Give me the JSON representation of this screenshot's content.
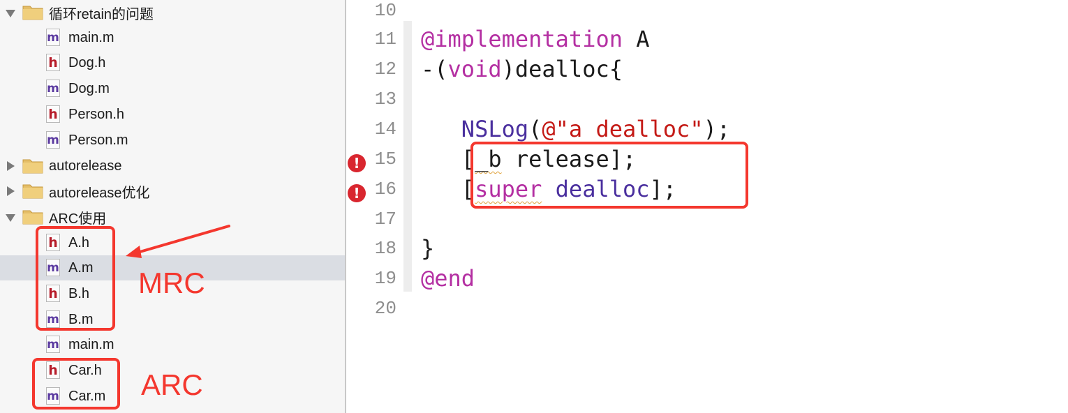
{
  "sidebar": {
    "groups": [
      {
        "name": "循环retain的问题",
        "expanded": true
      },
      {
        "name": "autorelease",
        "expanded": false
      },
      {
        "name": "autorelease优化",
        "expanded": false
      },
      {
        "name": "ARC使用",
        "expanded": true
      }
    ],
    "files_group1": [
      {
        "name": "main.m",
        "type": "m"
      },
      {
        "name": "Dog.h",
        "type": "h"
      },
      {
        "name": "Dog.m",
        "type": "m"
      },
      {
        "name": "Person.h",
        "type": "h"
      },
      {
        "name": "Person.m",
        "type": "m"
      }
    ],
    "files_arc": [
      {
        "name": "A.h",
        "type": "h"
      },
      {
        "name": "A.m",
        "type": "m",
        "selected": true
      },
      {
        "name": "B.h",
        "type": "h"
      },
      {
        "name": "B.m",
        "type": "m"
      },
      {
        "name": "main.m",
        "type": "m"
      },
      {
        "name": "Car.h",
        "type": "h"
      },
      {
        "name": "Car.m",
        "type": "m"
      }
    ],
    "file_icon_letters": {
      "h": "h",
      "m": "m"
    },
    "selected_file": "A.m"
  },
  "annotations": {
    "mrc_label": "MRC",
    "arc_label": "ARC",
    "color": "#f4372e"
  },
  "editor": {
    "lines": [
      {
        "no": "10"
      },
      {
        "no": "11"
      },
      {
        "no": "12"
      },
      {
        "no": "13"
      },
      {
        "no": "14"
      },
      {
        "no": "15",
        "error": true
      },
      {
        "no": "16",
        "error": true
      },
      {
        "no": "17"
      },
      {
        "no": "18"
      },
      {
        "no": "19"
      },
      {
        "no": "20"
      }
    ],
    "code": {
      "l11_kw": "@implementation",
      "l11_name": " A",
      "l12_a": "-(",
      "l12_kw": "void",
      "l12_b": ")dealloc{",
      "l14_indent": "   ",
      "l14_fn": "NSLog",
      "l14_open": "(",
      "l14_str": "@\"a dealloc\"",
      "l14_close": ");",
      "l15_indent": "   ",
      "l15_a": "[",
      "l15_var": "_b",
      "l15_b": " release];",
      "l16_indent": "   ",
      "l16_a": "[",
      "l16_kw": "super",
      "l16_sp": " ",
      "l16_fn": "dealloc",
      "l16_b": "];",
      "l18": "}",
      "l19_kw": "@end"
    },
    "error_icon": "!",
    "colors": {
      "keyword": "#b42fa2",
      "class": "#4a2f9e",
      "string": "#c41a16",
      "error": "#d9262f"
    }
  }
}
